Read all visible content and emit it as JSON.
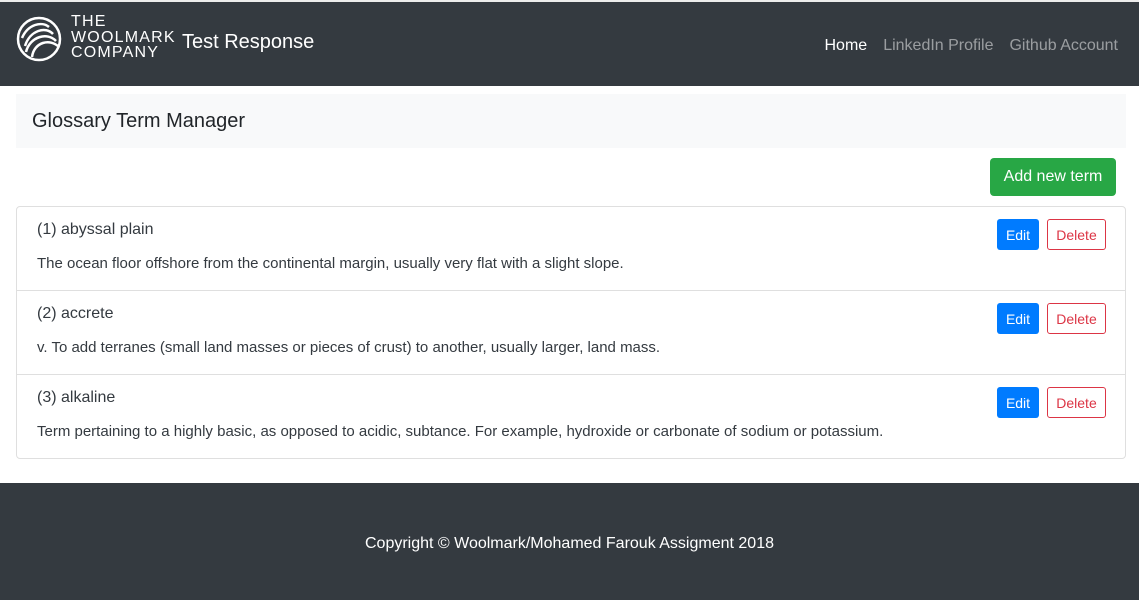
{
  "header": {
    "logo_lines": [
      "THE",
      "WOOLMARK",
      "COMPANY"
    ],
    "brand": "Test Response",
    "nav": [
      {
        "label": "Home",
        "active": true
      },
      {
        "label": "LinkedIn Profile",
        "active": false
      },
      {
        "label": "Github Account",
        "active": false
      }
    ]
  },
  "main": {
    "title": "Glossary Term Manager",
    "add_button": "Add new term",
    "terms": [
      {
        "title": "(1) abyssal plain",
        "definition": "The ocean floor offshore from the continental margin, usually very flat with a slight slope.",
        "edit": "Edit",
        "delete": "Delete"
      },
      {
        "title": "(2) accrete",
        "definition": "v. To add terranes (small land masses or pieces of crust) to another, usually larger, land mass.",
        "edit": "Edit",
        "delete": "Delete"
      },
      {
        "title": "(3) alkaline",
        "definition": "Term pertaining to a highly basic, as opposed to acidic, subtance. For example, hydroxide or carbonate of sodium or potassium.",
        "edit": "Edit",
        "delete": "Delete"
      }
    ]
  },
  "footer": {
    "copyright": "Copyright © Woolmark/Mohamed Farouk Assigment 2018"
  },
  "colors": {
    "navbar": "#343a40",
    "success": "#28a745",
    "primary": "#007bff",
    "danger": "#dc3545"
  }
}
